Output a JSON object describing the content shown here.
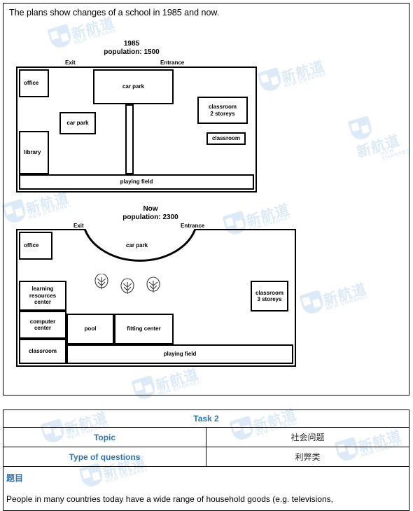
{
  "prompt": "The plans show changes of a school in 1985 and now.",
  "plan1985": {
    "title_line1": "1985",
    "title_line2": "population: 1500",
    "exit_label": "Exit",
    "entrance_label": "Entrance",
    "rooms": [
      {
        "key": "office",
        "label": "office"
      },
      {
        "key": "library",
        "label": "library"
      },
      {
        "key": "car_park_top",
        "label": "car park"
      },
      {
        "key": "car_park_small",
        "label": "car park"
      },
      {
        "key": "classroom_2storeys",
        "label": "classroom\n2 storeys"
      },
      {
        "key": "classroom_2storeys_l1",
        "label": "classroom"
      },
      {
        "key": "classroom_2storeys_l2",
        "label": "2 storeys"
      },
      {
        "key": "classroom",
        "label": "classroom"
      },
      {
        "key": "playing_field",
        "label": "playing field"
      }
    ]
  },
  "planNow": {
    "title_line1": "Now",
    "title_line2": "population: 2300",
    "exit_label": "Exit",
    "entrance_label": "Entrance",
    "car_park_label": "car park",
    "rooms": [
      {
        "key": "office",
        "label": "office"
      },
      {
        "key": "learning_resources_center_l1",
        "label": "learning"
      },
      {
        "key": "learning_resources_center_l2",
        "label": "resources"
      },
      {
        "key": "learning_resources_center_l3",
        "label": "center"
      },
      {
        "key": "computer_center_l1",
        "label": "computer"
      },
      {
        "key": "computer_center_l2",
        "label": "center"
      },
      {
        "key": "classroom",
        "label": "classroom"
      },
      {
        "key": "pool",
        "label": "pool"
      },
      {
        "key": "fitting_center",
        "label": "fitting center"
      },
      {
        "key": "playing_field",
        "label": "playing field"
      },
      {
        "key": "classroom_3storeys_l1",
        "label": "classroom"
      },
      {
        "key": "classroom_3storeys_l2",
        "label": "3 storeys"
      }
    ],
    "tree_count": 3
  },
  "task_table": {
    "header": "Task 2",
    "topic_key": "Topic",
    "topic_value": "社会问题",
    "type_key": "Type of questions",
    "type_value": "利弊类",
    "question_heading": "题目",
    "question_text": "People in many countries today have a wide range of household goods (e.g. televisions,"
  },
  "watermark": {
    "cn": "新航道",
    "en": "NEW CHANNEL"
  },
  "colors": {
    "accent_blue": "#2e75b6",
    "watermark_blue": "#dceaf7",
    "line_black": "#000000"
  }
}
